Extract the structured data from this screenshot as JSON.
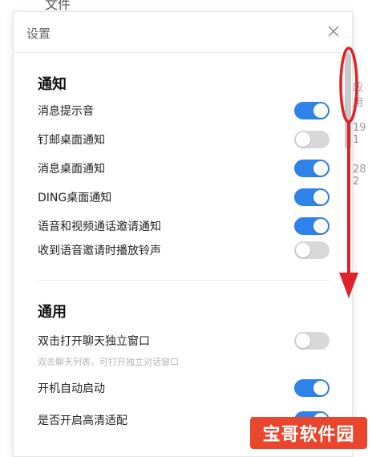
{
  "background": {
    "top_label": "文件",
    "fragments": [
      "应用",
      "19 1",
      "28 2"
    ]
  },
  "modal": {
    "title": "设置",
    "close_icon": "close-icon"
  },
  "sections": {
    "notify": {
      "title": "通知",
      "items": [
        {
          "label": "消息提示音",
          "on": true
        },
        {
          "label": "钉邮桌面通知",
          "on": false
        },
        {
          "label": "消息桌面通知",
          "on": true
        },
        {
          "label": "DING桌面通知",
          "on": true
        },
        {
          "label": "语音和视频通话邀请通知",
          "on": true
        },
        {
          "label": "收到语音邀请时播放铃声",
          "on": false
        }
      ]
    },
    "general": {
      "title": "通用",
      "items": [
        {
          "label": "双击打开聊天独立窗口",
          "sub": "双击聊天列表，可打开独立对话窗口",
          "on": false
        },
        {
          "label": "开机自动启动",
          "on": true
        },
        {
          "label": "是否开启高清适配",
          "on": true
        }
      ]
    }
  },
  "watermark": {
    "text": "宝哥软件园"
  },
  "colors": {
    "toggle_on": "#2f83e8",
    "toggle_off": "#d8d8d8",
    "annotation": "#e0222a"
  }
}
